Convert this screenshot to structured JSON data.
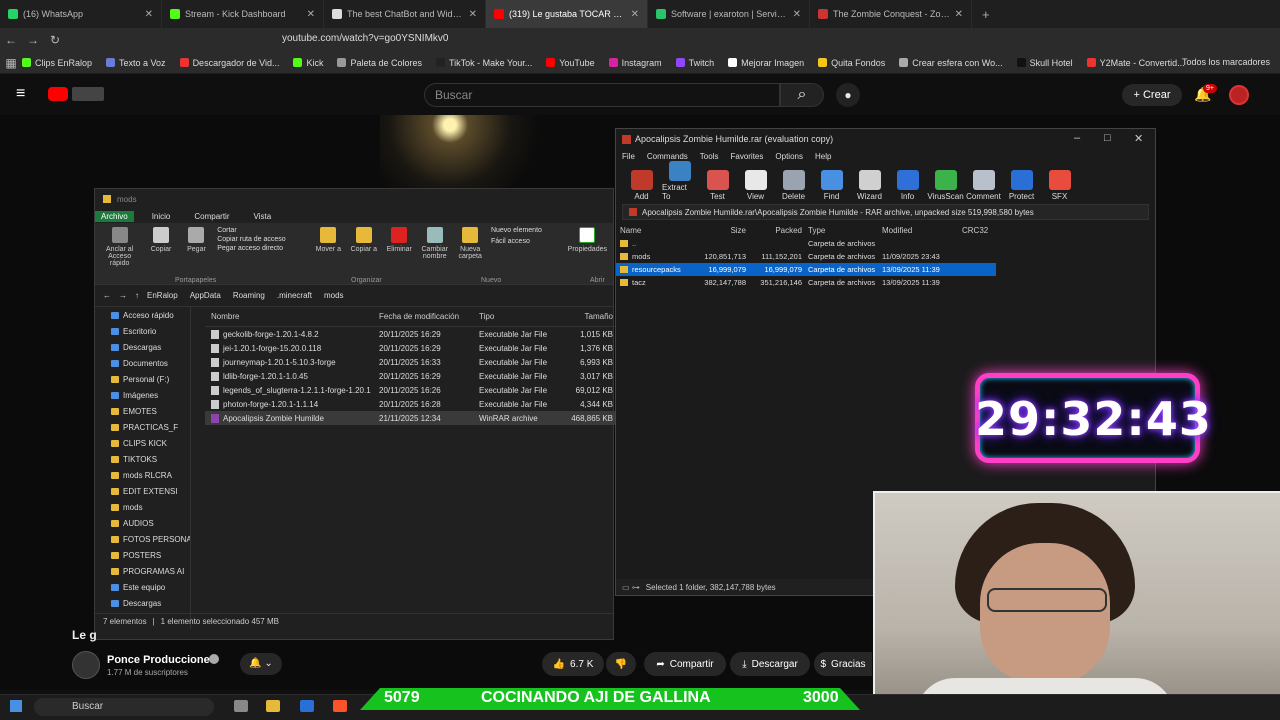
{
  "browser": {
    "tabs": [
      {
        "label": "(16) WhatsApp",
        "color": "#25d366"
      },
      {
        "label": "Stream - Kick Dashboard",
        "color": "#53fc18"
      },
      {
        "label": "The best ChatBot and Widgets for Ki",
        "color": "#dddddd"
      },
      {
        "label": "(319) Le gustaba TOCAR el MIC",
        "color": "#ff0000"
      },
      {
        "label": "Software | exaroton | Servidores de",
        "color": "#2bc36b"
      },
      {
        "label": "The Zombie Conquest - Zombie Apo",
        "color": "#cc3333"
      }
    ],
    "url": "youtube.com/watch?v=go0YSNIMkv0",
    "bookmarks": [
      {
        "label": "Clips EnRalop",
        "color": "#53fc18"
      },
      {
        "label": "Texto a Voz",
        "color": "#6a7bd8"
      },
      {
        "label": "Descargador de Vid...",
        "color": "#e33"
      },
      {
        "label": "Kick",
        "color": "#53fc18"
      },
      {
        "label": "Paleta de Colores",
        "color": "#999"
      },
      {
        "label": "TikTok - Make Your...",
        "color": "#222"
      },
      {
        "label": "YouTube",
        "color": "#ff0000"
      },
      {
        "label": "Instagram",
        "color": "#d6249f"
      },
      {
        "label": "Twitch",
        "color": "#9146ff"
      },
      {
        "label": "Mejorar Imagen",
        "color": "#fff"
      },
      {
        "label": "Quita Fondos",
        "color": "#f5c518"
      },
      {
        "label": "Crear esfera con Wo...",
        "color": "#aaa"
      },
      {
        "label": "Skull Hotel",
        "color": "#111"
      },
      {
        "label": "Y2Mate - Convertid...",
        "color": "#e33"
      }
    ],
    "all_bookmarks": "Todos los marcadores"
  },
  "youtube": {
    "search_placeholder": "Buscar",
    "create_label": "Crear",
    "notif_badge": "9+",
    "caption": "Le g",
    "channel_name": "Ponce Producciones",
    "subscribers": "1.77 M de suscriptores",
    "likes": "6.7 K",
    "share": "Compartir",
    "download": "Descargar",
    "thanks": "Gracias"
  },
  "explorer": {
    "title": "mods",
    "tabs": [
      "Archivo",
      "Inicio",
      "Compartir",
      "Vista"
    ],
    "ribbon": {
      "pin": "Anclar al Acceso rápido",
      "copy": "Copiar",
      "paste": "Pegar",
      "cut": "Cortar",
      "copy_path": "Copiar ruta de acceso",
      "paste_shortcut": "Pegar acceso directo",
      "move": "Mover a",
      "copy_to": "Copiar a",
      "delete": "Eliminar",
      "rename": "Cambiar nombre",
      "new_folder": "Nueva carpeta",
      "new_item": "Nuevo elemento",
      "easy_access": "Fácil acceso",
      "properties": "Propiedades",
      "open": "Abrir",
      "group_clipboard": "Portapapeles",
      "group_organize": "Organizar",
      "group_new": "Nuevo"
    },
    "breadcrumb": [
      "EnRalop",
      "AppData",
      "Roaming",
      ".minecraft",
      "mods"
    ],
    "columns": [
      "Nombre",
      "Fecha de modificación",
      "Tipo",
      "Tamaño"
    ],
    "files": [
      {
        "name": "geckolib-forge-1.20.1-4.8.2",
        "date": "20/11/2025 16:29",
        "type": "Executable Jar File",
        "size": "1,015 KB"
      },
      {
        "name": "jei-1.20.1-forge-15.20.0.118",
        "date": "20/11/2025 16:29",
        "type": "Executable Jar File",
        "size": "1,376 KB"
      },
      {
        "name": "journeymap-1.20.1-5.10.3-forge",
        "date": "20/11/2025 16:33",
        "type": "Executable Jar File",
        "size": "6,993 KB"
      },
      {
        "name": "ldlib-forge-1.20.1-1.0.45",
        "date": "20/11/2025 16:29",
        "type": "Executable Jar File",
        "size": "3,017 KB"
      },
      {
        "name": "legends_of_slugterra-1.2.1.1-forge-1.20.1",
        "date": "20/11/2025 16:26",
        "type": "Executable Jar File",
        "size": "69,012 KB"
      },
      {
        "name": "photon-forge-1.20.1-1.1.14",
        "date": "20/11/2025 16:28",
        "type": "Executable Jar File",
        "size": "4,344 KB"
      },
      {
        "name": "Apocalipsis Zombie Humilde",
        "date": "21/11/2025 12:34",
        "type": "WinRAR archive",
        "size": "468,865 KB"
      }
    ],
    "sidebar": [
      {
        "label": "Acceso rápido",
        "blue": true
      },
      {
        "label": "Escritorio",
        "blue": true
      },
      {
        "label": "Descargas",
        "blue": true
      },
      {
        "label": "Documentos",
        "blue": true
      },
      {
        "label": "Personal (F:)",
        "blue": false
      },
      {
        "label": "Imágenes",
        "blue": true
      },
      {
        "label": "EMOTES",
        "blue": false
      },
      {
        "label": "PRACTICAS_F",
        "blue": false
      },
      {
        "label": "CLIPS KICK",
        "blue": false
      },
      {
        "label": "TIKTOKS",
        "blue": false
      },
      {
        "label": "mods RLCRA",
        "blue": false
      },
      {
        "label": "EDIT EXTENSI",
        "blue": false
      },
      {
        "label": "mods",
        "blue": false
      },
      {
        "label": "AUDIOS",
        "blue": false
      },
      {
        "label": "FOTOS PERSONA",
        "blue": false
      },
      {
        "label": "POSTERS",
        "blue": false
      },
      {
        "label": "PROGRAMAS AI",
        "blue": false
      },
      {
        "label": "Este equipo",
        "blue": true
      },
      {
        "label": "Descargas",
        "blue": true
      }
    ],
    "status": [
      "7 elementos",
      "1 elemento seleccionado 457 MB"
    ]
  },
  "winrar": {
    "title": "Apocalipsis Zombie Humilde.rar (evaluation copy)",
    "menu": [
      "File",
      "Commands",
      "Tools",
      "Favorites",
      "Options",
      "Help"
    ],
    "tools": [
      {
        "label": "Add",
        "color": "#c0392b"
      },
      {
        "label": "Extract To",
        "color": "#3b82c4"
      },
      {
        "label": "Test",
        "color": "#d9534f"
      },
      {
        "label": "View",
        "color": "#e8e8e8"
      },
      {
        "label": "Delete",
        "color": "#9aa4b0"
      },
      {
        "label": "Find",
        "color": "#4a90e2"
      },
      {
        "label": "Wizard",
        "color": "#d0d0d0"
      },
      {
        "label": "Info",
        "color": "#2e6fd8"
      },
      {
        "label": "VirusScan",
        "color": "#3cb34a"
      },
      {
        "label": "Comment",
        "color": "#b8c0cc"
      },
      {
        "label": "Protect",
        "color": "#2a6fd6"
      },
      {
        "label": "SFX",
        "color": "#e74c3c"
      }
    ],
    "path": "Apocalipsis Zombie Humilde.rar\\Apocalipsis Zombie Humilde - RAR archive, unpacked size 519,998,580 bytes",
    "columns": [
      "Name",
      "Size",
      "Packed",
      "Type",
      "Modified",
      "CRC32"
    ],
    "rows": [
      {
        "name": "..",
        "size": "",
        "packed": "",
        "type": "Carpeta de archivos",
        "modified": ""
      },
      {
        "name": "mods",
        "size": "120,851,713",
        "packed": "111,152,201",
        "type": "Carpeta de archivos",
        "modified": "11/09/2025 23:43"
      },
      {
        "name": "resourcepacks",
        "size": "16,999,079",
        "packed": "16,999,079",
        "type": "Carpeta de archivos",
        "modified": "13/09/2025 11:39"
      },
      {
        "name": "tacz",
        "size": "382,147,788",
        "packed": "351,216,146",
        "type": "Carpeta de archivos",
        "modified": "13/09/2025 11:39"
      }
    ],
    "status": "Selected 1 folder, 382,147,788 bytes"
  },
  "overlay": {
    "timer": "29:32:43",
    "banner_left": "5079",
    "banner_text": "COCINANDO AJI DE GALLINA",
    "banner_right": "3000"
  },
  "taskbar": {
    "search": "Buscar"
  }
}
